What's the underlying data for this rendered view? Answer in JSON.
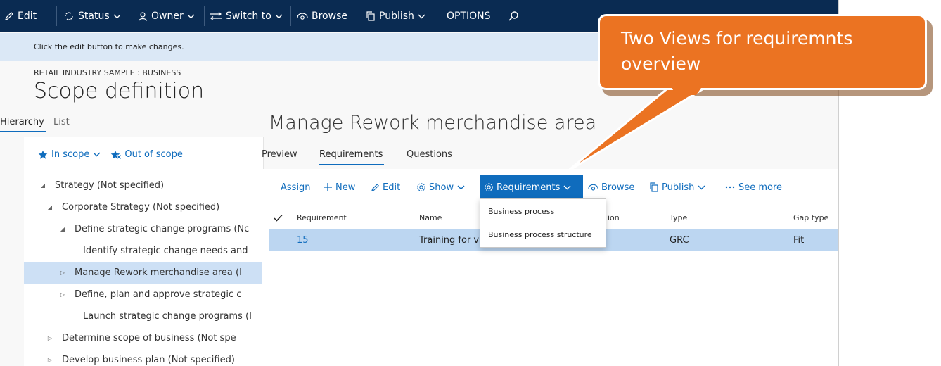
{
  "toolbar": {
    "edit": "Edit",
    "status": "Status",
    "owner": "Owner",
    "switch_to": "Switch to",
    "browse": "Browse",
    "publish": "Publish",
    "options": "OPTIONS"
  },
  "infobar": {
    "message": "Click the edit button to make changes."
  },
  "breadcrumb": "RETAIL INDUSTRY SAMPLE : BUSINESS",
  "page_title": "Scope definition",
  "left_tabs": {
    "hierarchy": "Hierarchy",
    "list": "List"
  },
  "scope_filters": {
    "in_scope": "In scope",
    "out_of_scope": "Out of scope"
  },
  "tree": [
    {
      "label": "Strategy (Not specified)",
      "level": 0,
      "expander": "expanded"
    },
    {
      "label": "Corporate Strategy (Not specified)",
      "level": 1,
      "expander": "expanded"
    },
    {
      "label": "Define strategic change programs (Nc",
      "level": 2,
      "expander": "expanded"
    },
    {
      "label": "Identify strategic change needs and",
      "level": 3,
      "expander": "none"
    },
    {
      "label": "Manage Rework merchandise area (I",
      "level": 2,
      "expander": "collapsed",
      "selected": true
    },
    {
      "label": "Define, plan and approve strategic c",
      "level": 2,
      "expander": "collapsed"
    },
    {
      "label": "Launch strategic change programs (I",
      "level": 3,
      "expander": "none"
    },
    {
      "label": "Determine scope of business (Not spe",
      "level": 1,
      "expander": "collapsed"
    },
    {
      "label": "Develop business plan (Not specified)",
      "level": 1,
      "expander": "collapsed"
    }
  ],
  "detail": {
    "title": "Manage Rework merchandise area",
    "tabs": [
      "Preview",
      "Requirements",
      "Questions"
    ],
    "selected_tab": "Requirements",
    "actions": {
      "assign": "Assign",
      "new": "New",
      "edit": "Edit",
      "show": "Show",
      "requirements": "Requirements",
      "browse": "Browse",
      "publish": "Publish",
      "see_more": "See more"
    },
    "columns": {
      "requirement": "Requirement",
      "name": "Name",
      "description": "ion",
      "type": "Type",
      "gap_type": "Gap type"
    },
    "rows": [
      {
        "requirement": "15",
        "name": "Training for v",
        "type": "GRC",
        "gap_type": "Fit"
      }
    ]
  },
  "requirements_menu": [
    "Business process",
    "Business process structure"
  ],
  "callout": {
    "text": "Two Views for requiremnts overview"
  },
  "colors": {
    "toolbar_bg": "#0a2b52",
    "accent": "#0f6cbd",
    "selected_row": "#bcd6f1",
    "infobar_bg": "#dbe8f6",
    "callout": "#eb7322"
  }
}
